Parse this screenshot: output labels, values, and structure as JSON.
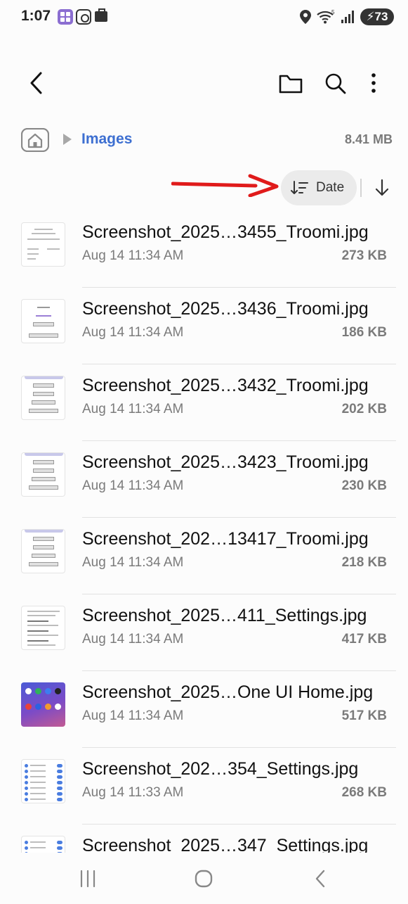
{
  "status_bar": {
    "time": "1:07",
    "battery": "73",
    "icons": [
      "app-notification-icon",
      "screen-recorder-icon",
      "work-profile-icon",
      "location-icon",
      "wifi-icon",
      "signal-icon",
      "battery-charging-icon"
    ]
  },
  "toolbar": {
    "icons": [
      "back-icon",
      "folder-icon",
      "search-icon",
      "more-options-icon"
    ]
  },
  "breadcrumb": {
    "home_icon": "home-icon",
    "current": "Images",
    "size": "8.41 MB"
  },
  "sort": {
    "label": "Date",
    "direction": "descending",
    "annotation_color": "#e01b1b"
  },
  "files": [
    {
      "name": "Screenshot_2025…3455_Troomi.jpg",
      "date": "Aug 14 11:34 AM",
      "size": "273 KB",
      "thumb": "doc"
    },
    {
      "name": "Screenshot_2025…3436_Troomi.jpg",
      "date": "Aug 14 11:34 AM",
      "size": "186 KB",
      "thumb": "code"
    },
    {
      "name": "Screenshot_2025…3432_Troomi.jpg",
      "date": "Aug 14 11:34 AM",
      "size": "202 KB",
      "thumb": "buttons"
    },
    {
      "name": "Screenshot_2025…3423_Troomi.jpg",
      "date": "Aug 14 11:34 AM",
      "size": "230 KB",
      "thumb": "buttons"
    },
    {
      "name": "Screenshot_202…13417_Troomi.jpg",
      "date": "Aug 14 11:34 AM",
      "size": "218 KB",
      "thumb": "buttons"
    },
    {
      "name": "Screenshot_2025…411_Settings.jpg",
      "date": "Aug 14 11:34 AM",
      "size": "417 KB",
      "thumb": "text"
    },
    {
      "name": "Screenshot_2025…One UI Home.jpg",
      "date": "Aug 14 11:34 AM",
      "size": "517 KB",
      "thumb": "home"
    },
    {
      "name": "Screenshot_202…354_Settings.jpg",
      "date": "Aug 14 11:33 AM",
      "size": "268 KB",
      "thumb": "toggles"
    },
    {
      "name": "Screenshot_2025…347_Settings.jpg",
      "date": "",
      "size": "",
      "thumb": "toggles"
    }
  ],
  "nav_bar": {
    "icons": [
      "recent-apps-icon",
      "home-nav-icon",
      "back-nav-icon"
    ]
  }
}
